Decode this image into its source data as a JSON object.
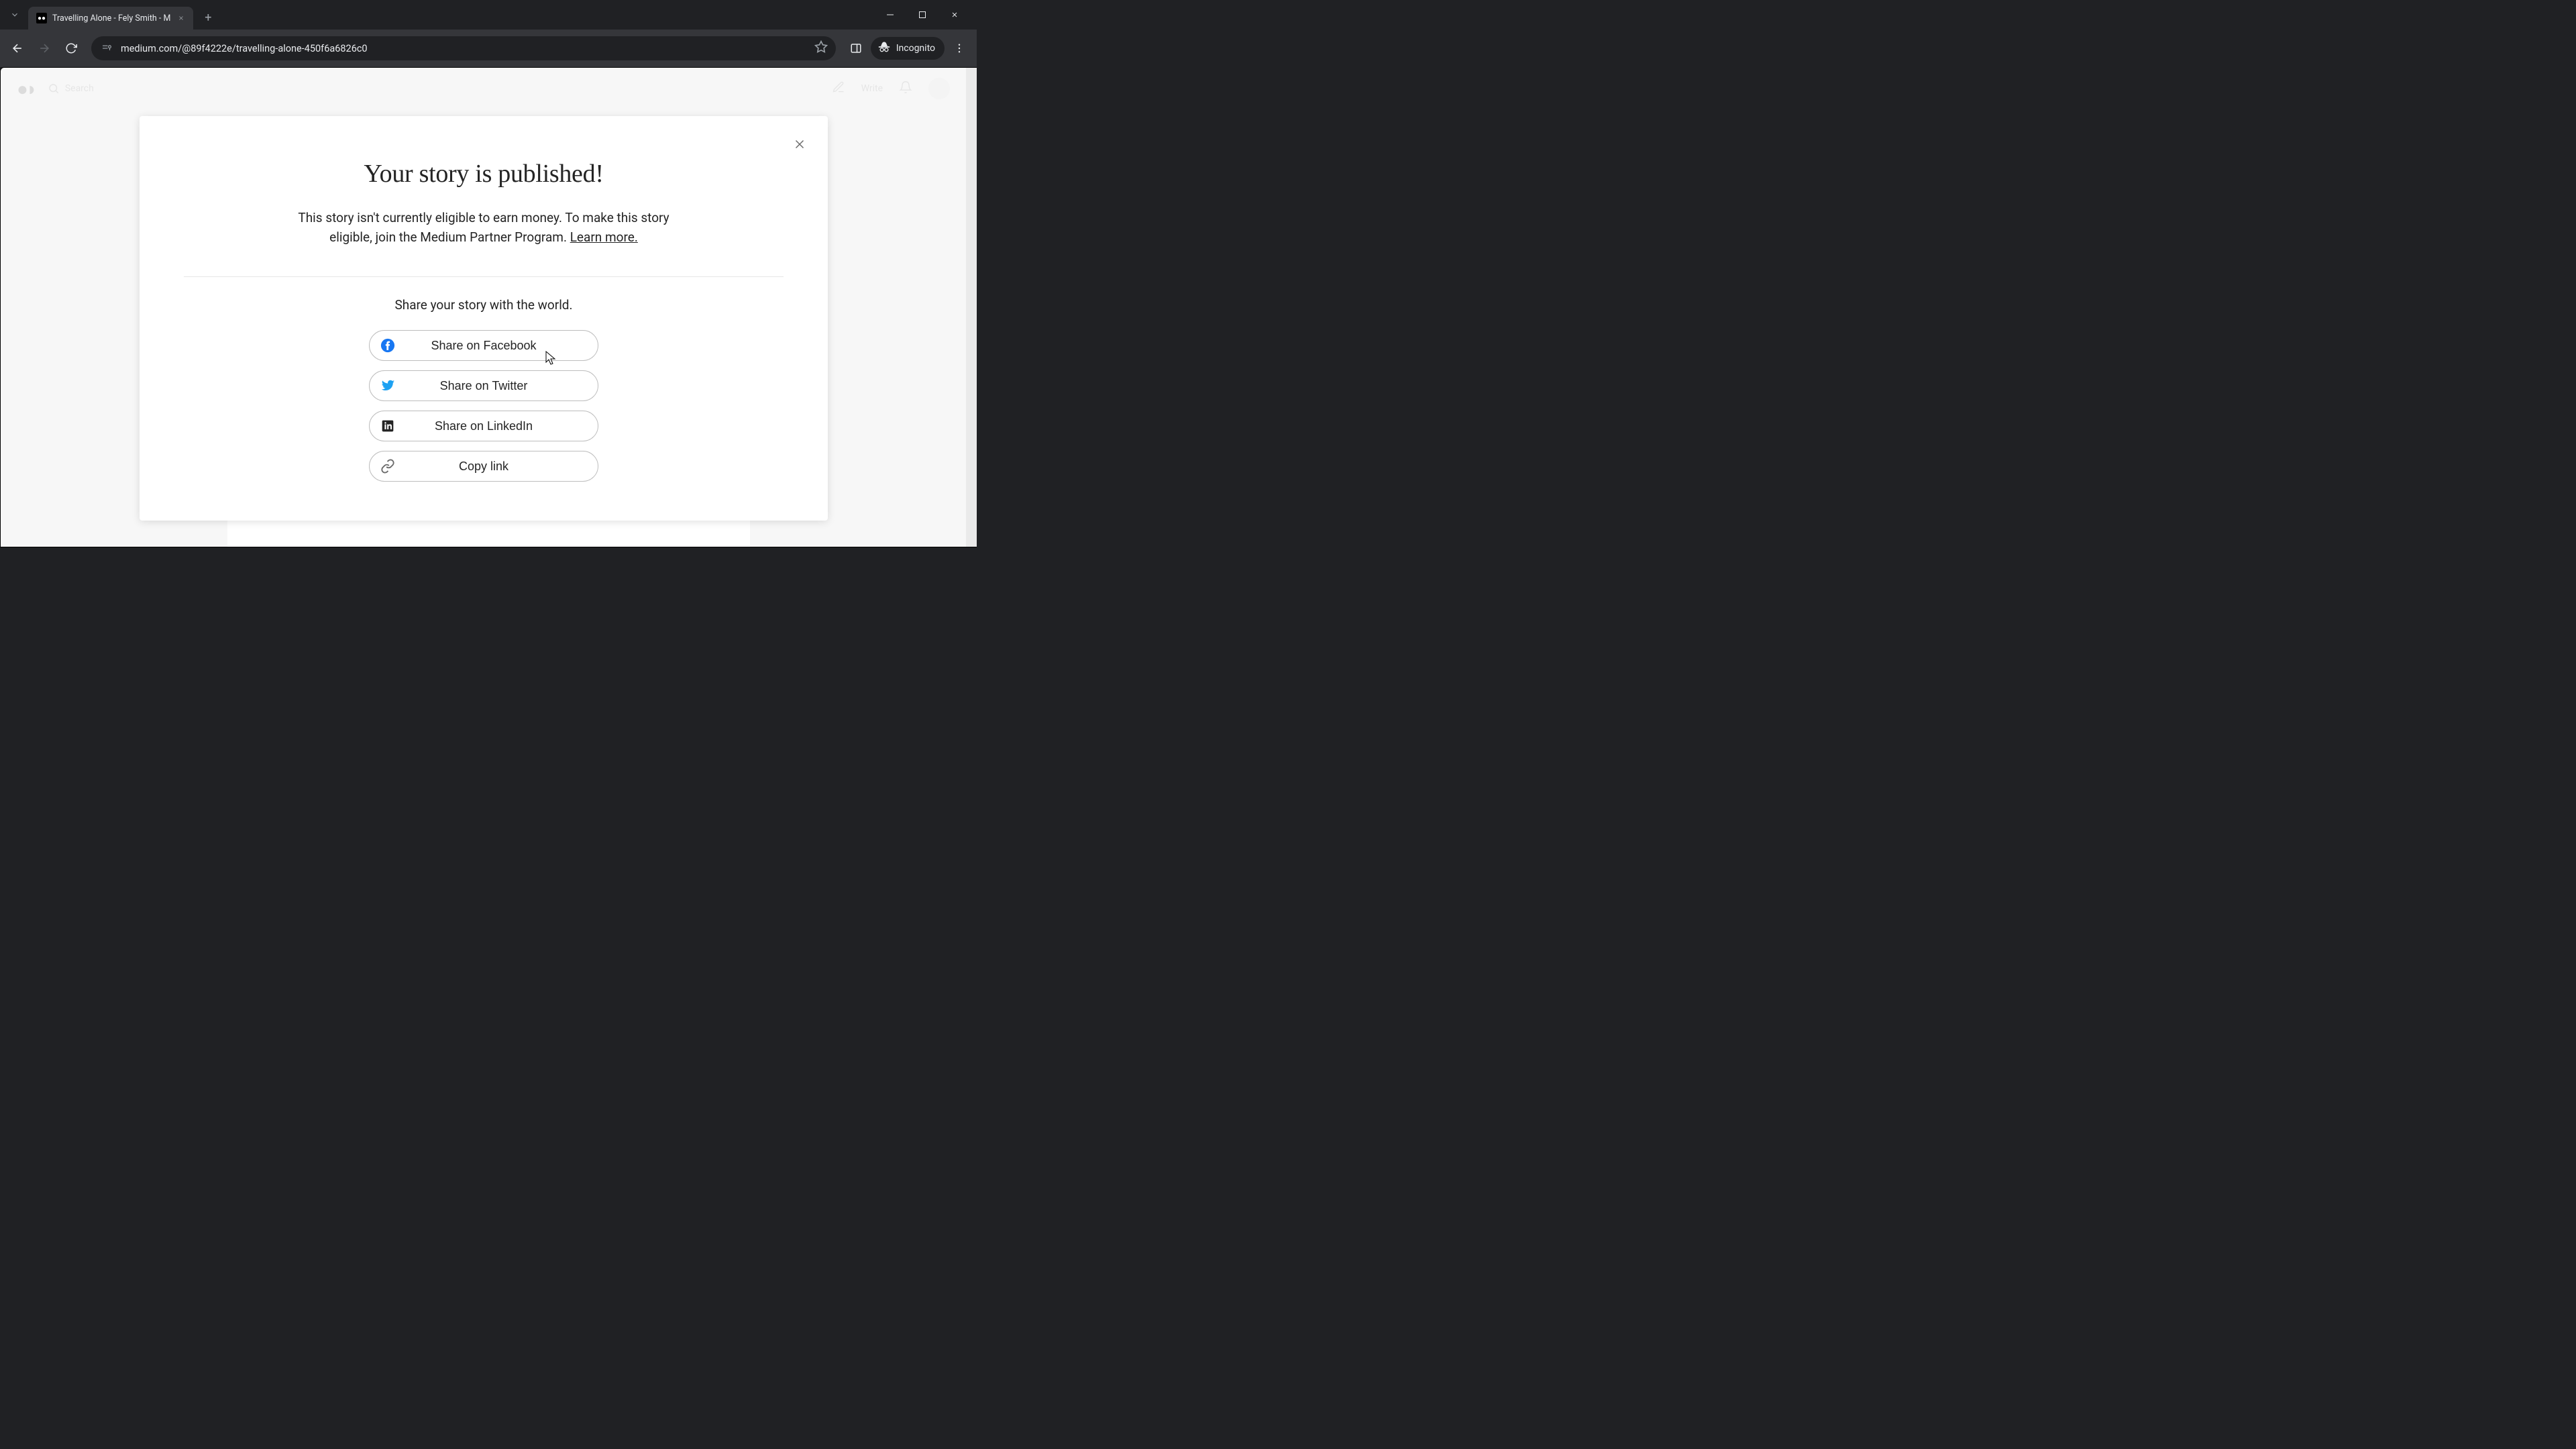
{
  "browser": {
    "tab_title": "Travelling Alone - Fely Smith - M",
    "url": "medium.com/@89f4222e/travelling-alone-450f6a6826c0",
    "incognito_label": "Incognito"
  },
  "bg": {
    "search_placeholder": "Search",
    "write": "Write"
  },
  "modal": {
    "title": "Your story is published!",
    "subtitle_a": "This story isn't currently eligible to earn money. To make this story eligible, join the Medium Partner Program. ",
    "learn_more": "Learn more.",
    "share_prompt": "Share your story with the world.",
    "share": {
      "facebook": "Share on Facebook",
      "twitter": "Share on Twitter",
      "linkedin": "Share on LinkedIn",
      "copy": "Copy link"
    }
  }
}
